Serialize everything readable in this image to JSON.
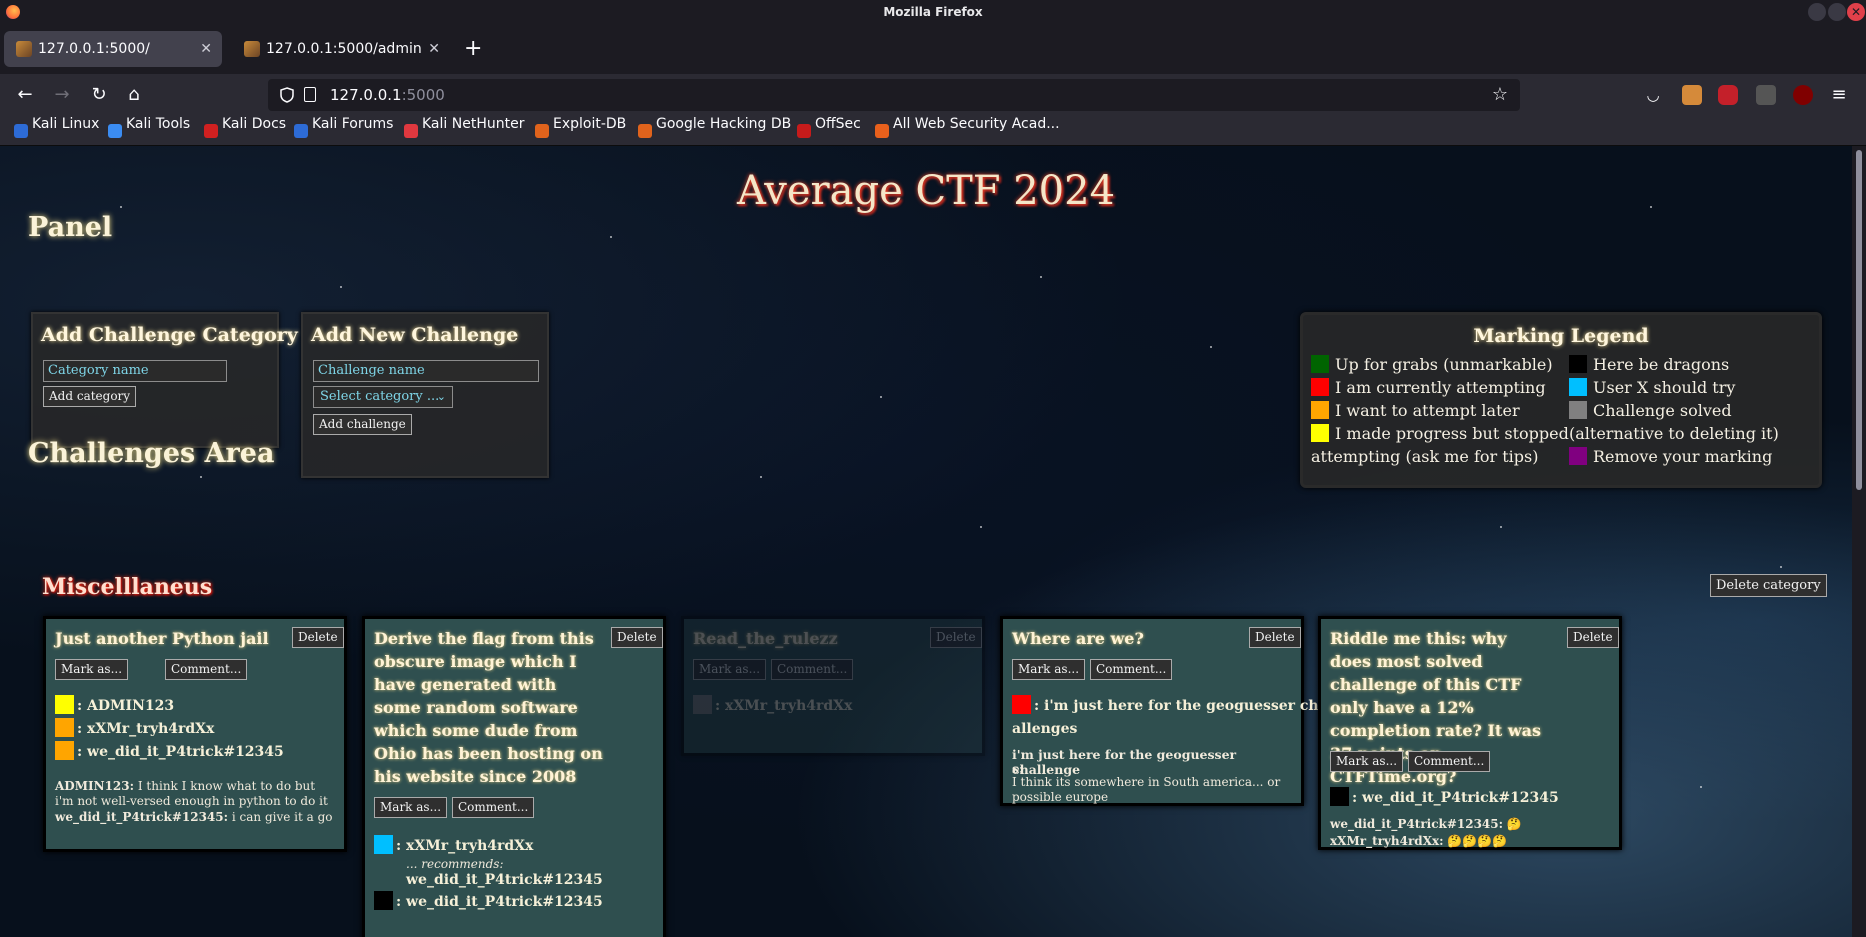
{
  "window_title": "Mozilla Firefox",
  "tabs": [
    {
      "label": "127.0.0.1:5000/"
    },
    {
      "label": "127.0.0.1:5000/admin"
    }
  ],
  "url": {
    "host": "127.0.0.1",
    "port": ":5000"
  },
  "bookmarks": [
    "Kali Linux",
    "Kali Tools",
    "Kali Docs",
    "Kali Forums",
    "Kali NetHunter",
    "Exploit-DB",
    "Google Hacking DB",
    "OffSec",
    "All Web Security Acad..."
  ],
  "site_title": "Average CTF 2024",
  "panel": {
    "heading": "Panel",
    "category_box": {
      "title": "Add Challenge Category",
      "placeholder": "Category name",
      "button": "Add category"
    },
    "challenge_box": {
      "title": "Add New Challenge",
      "placeholder": "Challenge name",
      "select": "Select category ...",
      "button": "Add challenge"
    }
  },
  "legend": {
    "title": "Marking Legend",
    "left": [
      {
        "color": "#006400",
        "label": "Up for grabs (unmarkable)"
      },
      {
        "color": "#ff0000",
        "label": "I am currently attempting"
      },
      {
        "color": "#ffa500",
        "label": "I want to attempt later"
      },
      {
        "color": "#ffff00",
        "label": "I made progress but stopped"
      }
    ],
    "left_wrap": "attempting (ask me for tips)",
    "right": [
      {
        "color": "#000000",
        "label": "Here be dragons"
      },
      {
        "color": "#00bfff",
        "label": "User X should try"
      },
      {
        "color": "#808080",
        "label": "Challenge solved"
      }
    ],
    "right_wrap": "(alternative to deleting it)",
    "right_last": {
      "color": "#800080",
      "label": "Remove your marking"
    }
  },
  "challenges_area": {
    "heading": "Challenges Area",
    "category": "Miscelllaneus",
    "delete_category": "Delete category",
    "delete": "Delete",
    "mark_as": "Mark as...",
    "comment": "Comment...",
    "cards": [
      {
        "title": "Just another Python jail",
        "marks": [
          {
            "color": "#ffff00",
            "user": ": ADMIN123"
          },
          {
            "color": "#ffa500",
            "user": ": xXMr_tryh4rdXx"
          },
          {
            "color": "#ffa500",
            "user": ": we_did_it_P4trick#12345"
          }
        ],
        "comments": [
          {
            "author": "ADMIN123:",
            "text": " I think I know what to do but i'm not well-versed enough in python to do it"
          },
          {
            "author": "we_did_it_P4trick#12345:",
            "text": " i can give it a go"
          }
        ]
      },
      {
        "title": "Derive the flag from this obscure image which I have generated with some random software which some dude from Ohio has been hosting on his website since 2008",
        "marks": [
          {
            "color": "#00bfff",
            "user": ": xXMr_tryh4rdXx"
          },
          {
            "color": "#000000",
            "user": ": we_did_it_P4trick#12345"
          }
        ],
        "recommends": "... recommends:",
        "recommended": "we_did_it_P4trick#12345"
      },
      {
        "title": "Read_the_rulezz",
        "marks": [
          {
            "color": "#808080",
            "user": ": xXMr_tryh4rdXx"
          }
        ]
      },
      {
        "title": "Where are we?",
        "marks": [
          {
            "color": "#ff0000",
            "user": ": i'm just here for the geoguesser ch",
            "user2": "allenges"
          }
        ],
        "comment_author": "i'm just here for the geoguesser challenge",
        "comment_author2": "s:",
        "comment_text": " I think its somewhere in South america... or possible europe"
      },
      {
        "title": "Riddle me this: why does most solved challenge of this CTF only have a 12% completion rate? It was 37 points on CTFTime.org?",
        "marks": [
          {
            "color": "#000000",
            "user": ": we_did_it_P4trick#12345"
          }
        ],
        "comments": [
          {
            "author": "we_did_it_P4trick#12345:",
            "text": " 🤔"
          },
          {
            "author": "xXMr_tryh4rdXx:",
            "text": " 🤔🤔🤔🤔"
          }
        ]
      }
    ]
  }
}
